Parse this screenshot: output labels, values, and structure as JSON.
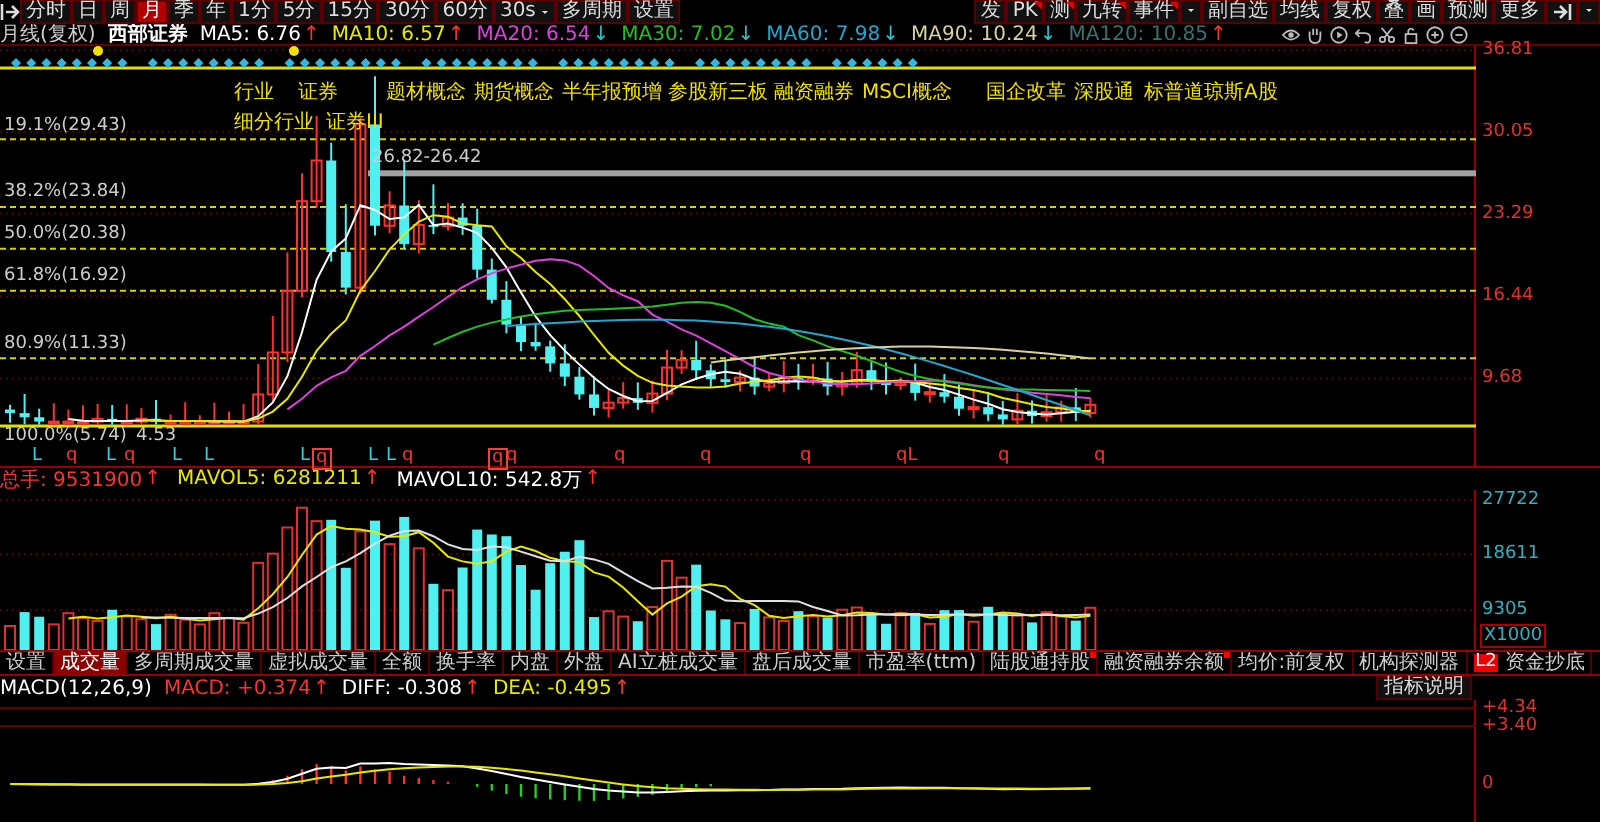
{
  "periods": [
    {
      "label": "分时",
      "selected": false
    },
    {
      "label": "日",
      "selected": false
    },
    {
      "label": "周",
      "selected": false
    },
    {
      "label": "月",
      "selected": true
    },
    {
      "label": "季",
      "selected": false
    },
    {
      "label": "年",
      "selected": false
    },
    {
      "label": "1分",
      "selected": false
    },
    {
      "label": "5分",
      "selected": false
    },
    {
      "label": "15分",
      "selected": false
    },
    {
      "label": "30分",
      "selected": false
    },
    {
      "label": "60分",
      "selected": false
    }
  ],
  "period_dropdown": {
    "value": "30s"
  },
  "toolbar_buttons": [
    "多周期",
    "设置"
  ],
  "toolbar_right": [
    {
      "label": "发",
      "marked": false
    },
    {
      "label": "PK",
      "marked": true
    },
    {
      "label": "测",
      "marked": true
    },
    {
      "label": "九转",
      "marked": true
    },
    {
      "label": "事件",
      "marked": true
    }
  ],
  "tools": [
    "副自选",
    "均线",
    "复权",
    "叠",
    "画",
    "预测",
    "更多"
  ],
  "legend": {
    "period": "月线(复权)",
    "stock": "西部证券",
    "indicators": [
      {
        "text": "MA5: 6.76",
        "color": "#ffffff",
        "arrow": {
          "text": "↑",
          "color": "#ff3030"
        }
      },
      {
        "text": "MA10: 6.57",
        "color": "#e8e800",
        "arrow": {
          "text": "↑",
          "color": "#ff3030"
        }
      },
      {
        "text": "MA20: 6.54",
        "color": "#e040e0",
        "arrow": {
          "text": "↓",
          "color": "#30c0d0"
        }
      },
      {
        "text": "MA30: 7.02",
        "color": "#20c020",
        "arrow": {
          "text": "↓",
          "color": "#30c0d0"
        }
      },
      {
        "text": "MA60: 7.98",
        "color": "#20a8d0",
        "arrow": {
          "text": "↓",
          "color": "#30c0d0"
        }
      },
      {
        "text": "MA90: 10.24",
        "color": "#d8d0a0",
        "arrow": {
          "text": "↓",
          "color": "#30c0d0"
        }
      },
      {
        "text": "MA120: 10.85",
        "color": "#3a7070",
        "arrow": {
          "text": "↑",
          "color": "#ff3030"
        }
      }
    ]
  },
  "price_axis": [
    "36.81",
    "30.05",
    "23.29",
    "16.44",
    "9.68"
  ],
  "concepts": {
    "industry": [
      "行业",
      "证券"
    ],
    "sub_industry": [
      "细分行业",
      "证券III"
    ],
    "themes": [
      "题材概念",
      "期货概念",
      "半年报预增",
      "参股新三板",
      "融资融券",
      "MSCI概念",
      "国企改革",
      "深股通",
      "标普道琼斯A股"
    ]
  },
  "fib_levels": [
    "19.1%(29.43)",
    "38.2%(23.84)",
    "50.0%(20.38)",
    "61.8%(16.92)",
    "80.9%(11.33)",
    "100.0%(5.74)"
  ],
  "range_label": "26.82-26.42",
  "low_label": "4.53",
  "markers": [
    {
      "text": "L",
      "boxed": false
    },
    {
      "text": "q",
      "boxed": false
    },
    {
      "text": "L",
      "boxed": false
    },
    {
      "text": "q",
      "boxed": false
    },
    {
      "text": "L",
      "boxed": false
    },
    {
      "text": "L",
      "boxed": false
    },
    {
      "text": "L",
      "boxed": false
    },
    {
      "text": "q",
      "boxed": true
    },
    {
      "text": "L",
      "boxed": false
    },
    {
      "text": "L",
      "boxed": false
    },
    {
      "text": "q",
      "boxed": false
    },
    {
      "text": "q",
      "boxed": true
    },
    {
      "text": "q",
      "boxed": false
    },
    {
      "text": "q",
      "boxed": false
    },
    {
      "text": "q",
      "boxed": false
    },
    {
      "text": "q",
      "boxed": false
    },
    {
      "text": "qL",
      "boxed": false
    },
    {
      "text": "q",
      "boxed": false
    },
    {
      "text": "q",
      "boxed": false
    }
  ],
  "volume": {
    "values": [
      {
        "text": "总手: 9531900",
        "color": "#ff3030",
        "arrow": {
          "text": "↑",
          "color": "#ff3030"
        }
      },
      {
        "text": "MAVOL5: 6281211",
        "color": "#e8e800",
        "arrow": {
          "text": "↑",
          "color": "#ff3030"
        }
      },
      {
        "text": "MAVOL10: 542.8万",
        "color": "#ffffff",
        "arrow": {
          "text": "↑",
          "color": "#ff3030"
        }
      }
    ],
    "axis": [
      "27722",
      "18611",
      "9305"
    ],
    "unit": "X1000"
  },
  "tabs": [
    {
      "label": "设置",
      "selected": false,
      "marked": false
    },
    {
      "label": "成交量",
      "selected": true,
      "marked": false
    },
    {
      "label": "多周期成交量",
      "selected": false,
      "marked": false
    },
    {
      "label": "虚拟成交量",
      "selected": false,
      "marked": false
    },
    {
      "label": "全额",
      "selected": false,
      "marked": false
    },
    {
      "label": "换手率",
      "selected": false,
      "marked": false
    },
    {
      "label": "内盘",
      "selected": false,
      "marked": false
    },
    {
      "label": "外盘",
      "selected": false,
      "marked": false
    },
    {
      "label": "AI立桩成交量",
      "selected": false,
      "marked": false
    },
    {
      "label": "盘后成交量",
      "selected": false,
      "marked": false
    },
    {
      "label": "市盈率(ttm)",
      "selected": false,
      "marked": false
    },
    {
      "label": "陆股通持股",
      "selected": false,
      "marked": true
    },
    {
      "label": "融资融券余额",
      "selected": false,
      "marked": true
    },
    {
      "label": "均价:前复权",
      "selected": false,
      "marked": false
    },
    {
      "label": "机构探测器",
      "selected": false,
      "marked": false
    }
  ],
  "l2_tab": {
    "badge": "L2",
    "label": "资金抄底"
  },
  "macd": {
    "values": [
      {
        "text": "MACD(12,26,9)",
        "color": "#ffffff"
      },
      {
        "text": "MACD: +0.374",
        "color": "#ff3030",
        "arrow": {
          "text": "↑",
          "color": "#ff3030"
        }
      },
      {
        "text": "DIFF: -0.308",
        "color": "#ffffff",
        "arrow": {
          "text": "↑",
          "color": "#ff3030"
        }
      },
      {
        "text": "DEA: -0.495",
        "color": "#e8e800",
        "arrow": {
          "text": "↑",
          "color": "#ff3030"
        }
      }
    ],
    "help": "指标说明",
    "axis": [
      "+4.34",
      "+3.40",
      "0"
    ]
  }
}
